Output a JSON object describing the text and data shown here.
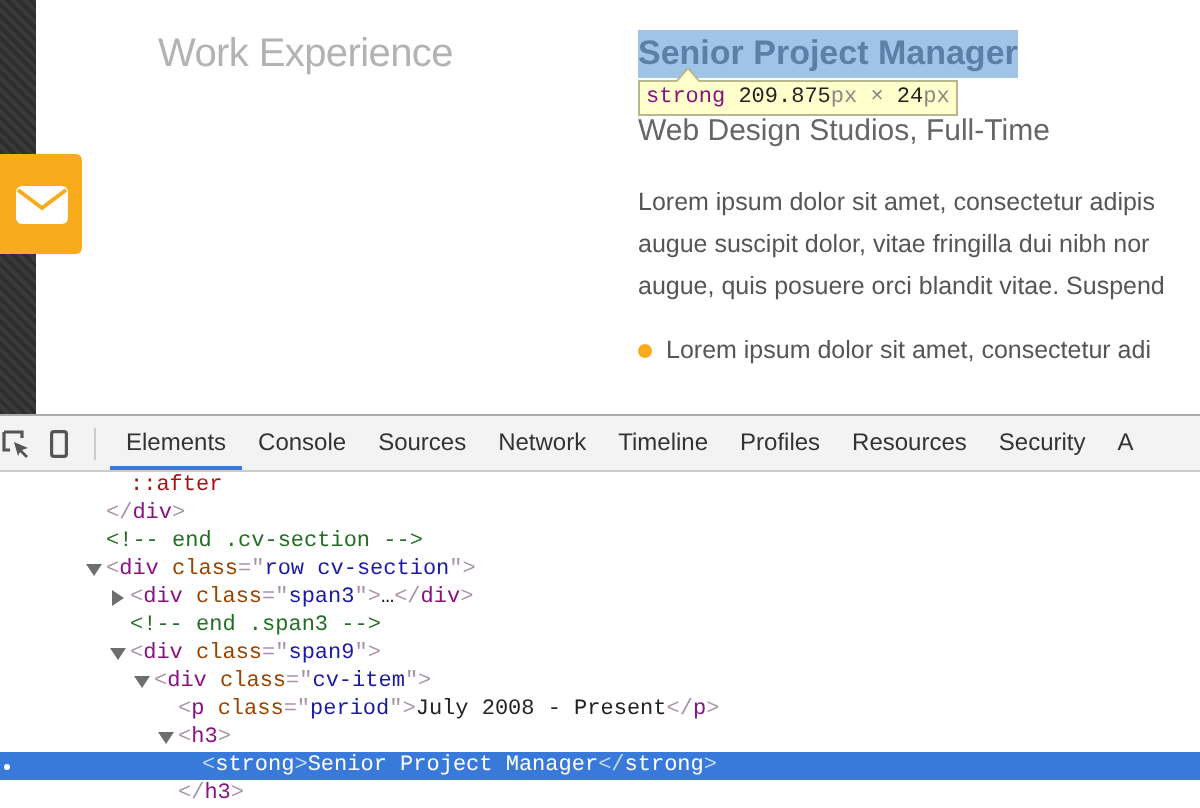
{
  "page": {
    "section_title": "Work Experience",
    "job_title": "Senior Project Manager",
    "job_title_highlighted": true,
    "company": "Web Design Studios, Full-Time",
    "paragraph": [
      "Lorem ipsum dolor sit amet, consectetur adipis",
      "augue suscipit dolor, vitae fringilla dui nibh nor",
      "augue, quis posuere orci blandit vitae. Suspend"
    ],
    "bullets": [
      "Lorem ipsum dolor sit amet, consectetur adi"
    ]
  },
  "tooltip": [
    {
      "kind": "tag",
      "text": "strong"
    },
    {
      "kind": "number",
      "text": "209.875"
    },
    {
      "kind": "unit",
      "text": "px"
    },
    {
      "kind": "sep",
      "text": "×"
    },
    {
      "kind": "number",
      "text": "24"
    },
    {
      "kind": "unit",
      "text": "px"
    }
  ],
  "devtools": {
    "tabs": [
      {
        "label": "Elements",
        "selected": true
      },
      {
        "label": "Console",
        "selected": false
      },
      {
        "label": "Sources",
        "selected": false
      },
      {
        "label": "Network",
        "selected": false
      },
      {
        "label": "Timeline",
        "selected": false
      },
      {
        "label": "Profiles",
        "selected": false
      },
      {
        "label": "Resources",
        "selected": false
      },
      {
        "label": "Security",
        "selected": false
      },
      {
        "label": "A",
        "selected": false
      }
    ],
    "tree": [
      {
        "children": [
          {
            "selected": false,
            "open": [
              {
                "kind": "pseudo",
                "text": "::after"
              }
            ]
          }
        ],
        "close": [
          {
            "kind": "punct",
            "text": "</"
          },
          {
            "kind": "tag",
            "text": "div"
          },
          {
            "kind": "punct",
            "text": ">"
          }
        ]
      },
      {
        "selected": false,
        "open": [
          {
            "kind": "comment",
            "text": "<!-- end .cv-section -->"
          }
        ]
      },
      {
        "selected": false,
        "expanded": true,
        "open": [
          {
            "kind": "punct",
            "text": "<"
          },
          {
            "kind": "tag",
            "text": "div"
          },
          {
            "kind": "attr",
            "text": "class"
          },
          {
            "kind": "punct",
            "text": "=\""
          },
          {
            "kind": "value",
            "text": "row cv-section"
          },
          {
            "kind": "punct",
            "text": "\">"
          }
        ],
        "children": [
          {
            "selected": false,
            "expanded": false,
            "open": [
              {
                "kind": "punct",
                "text": "<"
              },
              {
                "kind": "tag",
                "text": "div"
              },
              {
                "kind": "attr",
                "text": "class"
              },
              {
                "kind": "punct",
                "text": "=\""
              },
              {
                "kind": "value",
                "text": "span3"
              },
              {
                "kind": "punct",
                "text": "\">"
              },
              {
                "kind": "text",
                "text": "…"
              },
              {
                "kind": "punct",
                "text": "</"
              },
              {
                "kind": "tag",
                "text": "div"
              },
              {
                "kind": "punct",
                "text": ">"
              }
            ]
          },
          {
            "selected": false,
            "open": [
              {
                "kind": "comment",
                "text": "<!-- end .span3 -->"
              }
            ]
          },
          {
            "selected": false,
            "expanded": true,
            "open": [
              {
                "kind": "punct",
                "text": "<"
              },
              {
                "kind": "tag",
                "text": "div"
              },
              {
                "kind": "attr",
                "text": "class"
              },
              {
                "kind": "punct",
                "text": "=\""
              },
              {
                "kind": "value",
                "text": "span9"
              },
              {
                "kind": "punct",
                "text": "\">"
              }
            ],
            "children": [
              {
                "selected": false,
                "expanded": true,
                "open": [
                  {
                    "kind": "punct",
                    "text": "<"
                  },
                  {
                    "kind": "tag",
                    "text": "div"
                  },
                  {
                    "kind": "attr",
                    "text": "class"
                  },
                  {
                    "kind": "punct",
                    "text": "=\""
                  },
                  {
                    "kind": "value",
                    "text": "cv-item"
                  },
                  {
                    "kind": "punct",
                    "text": "\">"
                  }
                ],
                "children": [
                  {
                    "selected": false,
                    "open": [
                      {
                        "kind": "punct",
                        "text": "<"
                      },
                      {
                        "kind": "tag",
                        "text": "p"
                      },
                      {
                        "kind": "attr",
                        "text": "class"
                      },
                      {
                        "kind": "punct",
                        "text": "=\""
                      },
                      {
                        "kind": "value",
                        "text": "period"
                      },
                      {
                        "kind": "punct",
                        "text": "\">"
                      },
                      {
                        "kind": "text",
                        "text": "July 2008 - Present"
                      },
                      {
                        "kind": "punct",
                        "text": "</"
                      },
                      {
                        "kind": "tag",
                        "text": "p"
                      },
                      {
                        "kind": "punct",
                        "text": ">"
                      }
                    ]
                  },
                  {
                    "selected": false,
                    "expanded": true,
                    "open": [
                      {
                        "kind": "punct",
                        "text": "<"
                      },
                      {
                        "kind": "tag",
                        "text": "h3"
                      },
                      {
                        "kind": "punct",
                        "text": ">"
                      }
                    ],
                    "children": [
                      {
                        "selected": true,
                        "open": [
                          {
                            "kind": "punct",
                            "text": "<"
                          },
                          {
                            "kind": "tag",
                            "text": "strong"
                          },
                          {
                            "kind": "punct",
                            "text": ">"
                          },
                          {
                            "kind": "text",
                            "text": "Senior Project Manager"
                          },
                          {
                            "kind": "punct",
                            "text": "</"
                          },
                          {
                            "kind": "tag",
                            "text": "strong"
                          },
                          {
                            "kind": "punct",
                            "text": ">"
                          }
                        ]
                      }
                    ],
                    "close": [
                      {
                        "kind": "punct",
                        "text": "</"
                      },
                      {
                        "kind": "tag",
                        "text": "h3"
                      },
                      {
                        "kind": "punct",
                        "text": ">"
                      }
                    ]
                  }
                ]
              }
            ]
          }
        ]
      }
    ]
  }
}
